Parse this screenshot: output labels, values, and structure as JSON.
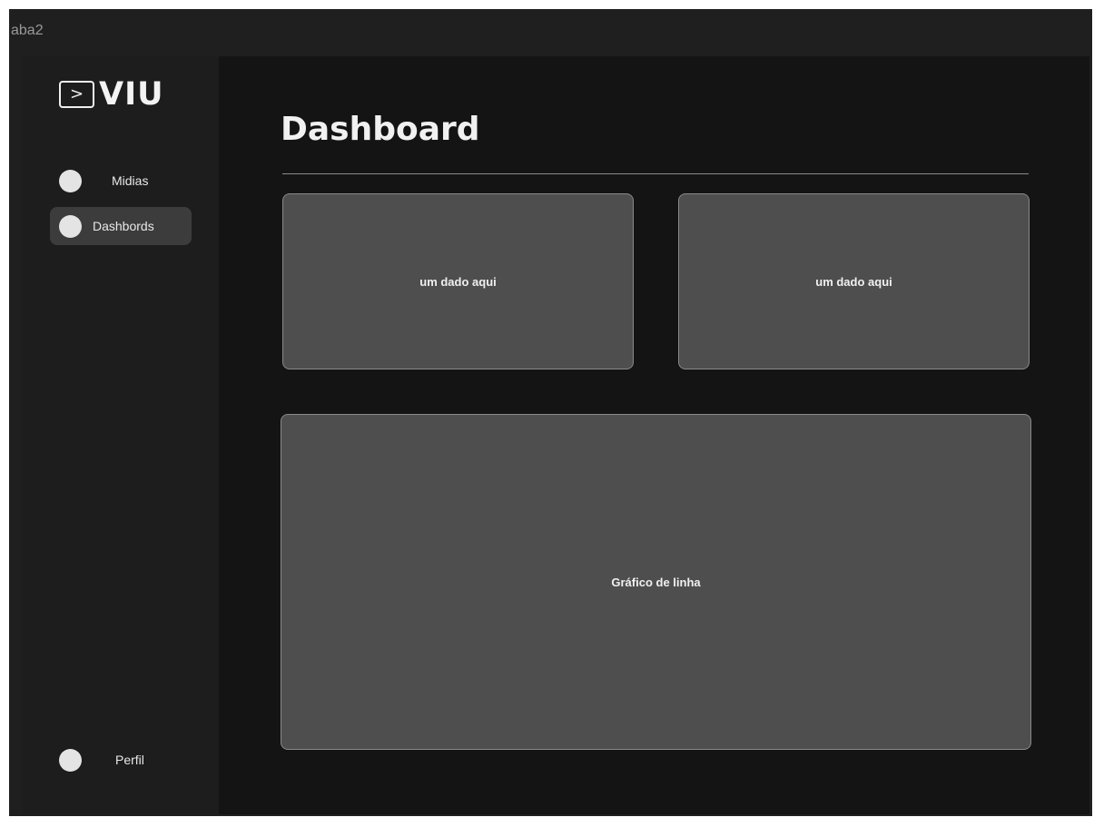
{
  "window": {
    "frame_label": "aba2"
  },
  "sidebar": {
    "logo_glyph": ">",
    "logo_text": "VIU",
    "items": [
      {
        "label": "Midias",
        "active": false
      },
      {
        "label": "Dashbords",
        "active": true
      }
    ],
    "profile": {
      "label": "Perfil"
    }
  },
  "main": {
    "title": "Dashboard",
    "cards": [
      {
        "label": "um dado aqui"
      },
      {
        "label": "um dado aqui"
      }
    ],
    "chart_panel": {
      "label": "Gráfico de linha"
    }
  },
  "colors": {
    "background": "#141414",
    "sidebar": "#1d1d1d",
    "card": "#4e4e4e",
    "active_item": "#3c3c3c",
    "text": "#f0f0f0"
  }
}
